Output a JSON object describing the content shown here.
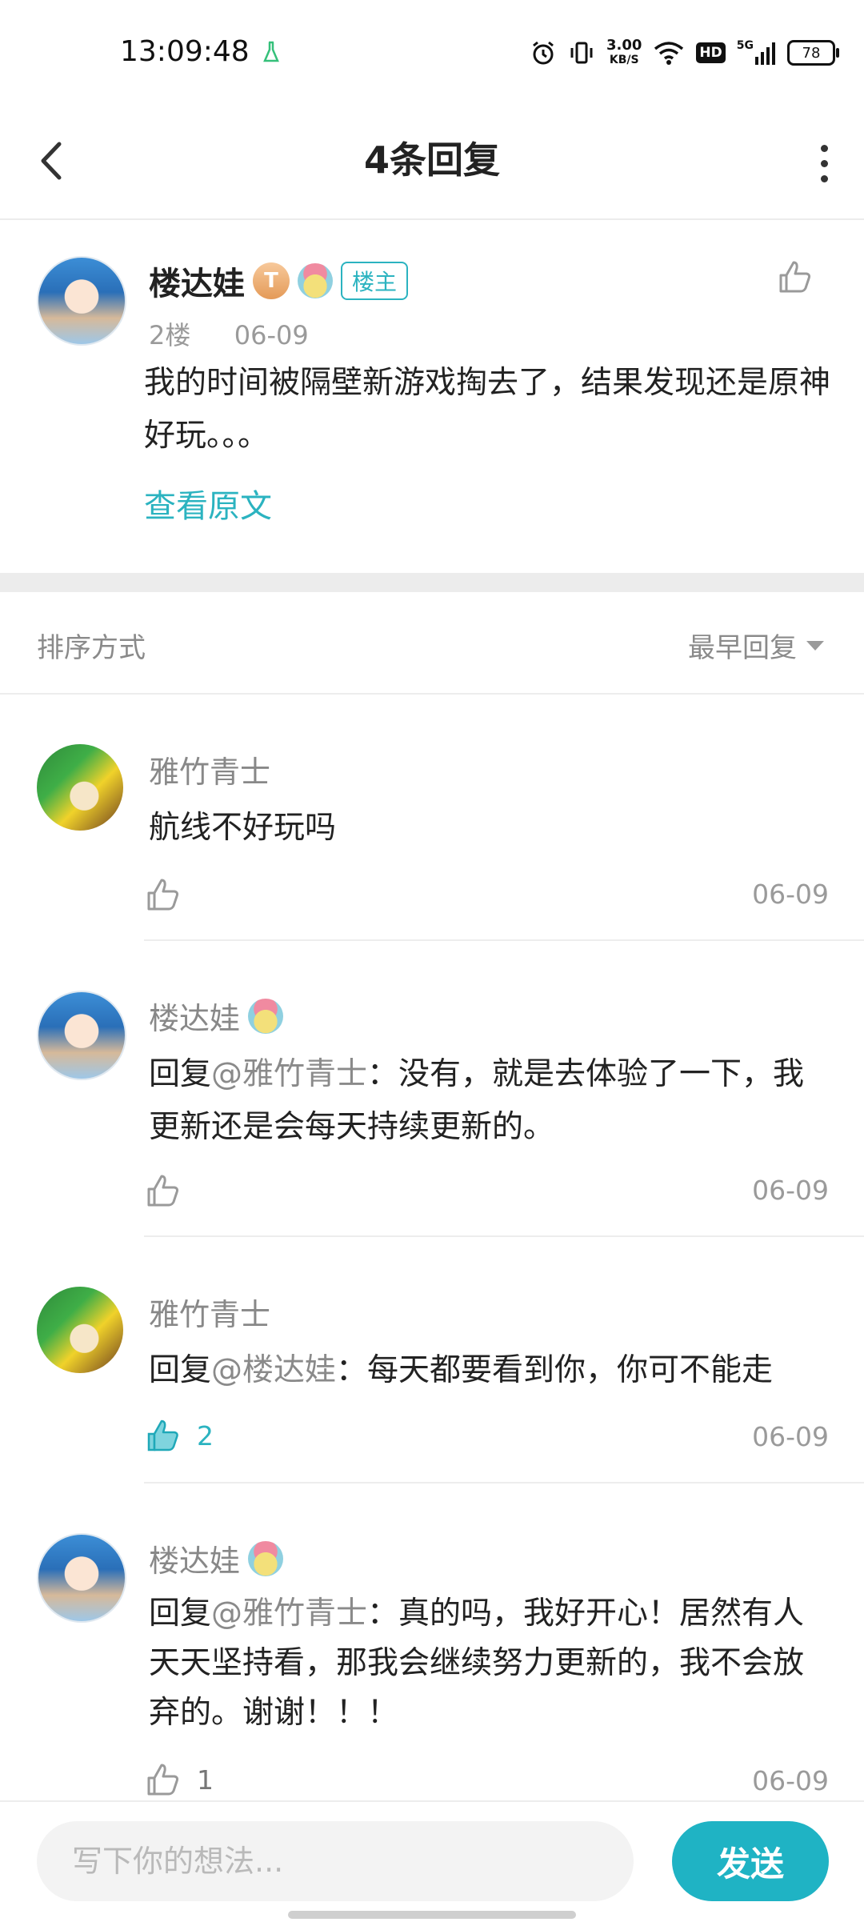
{
  "status_bar": {
    "time": "13:09:48",
    "net_speed_value": "3.00",
    "net_speed_unit": "KB/S",
    "hd": "HD",
    "signal_label": "5G",
    "battery": "78"
  },
  "nav": {
    "title": "4条回复"
  },
  "op_post": {
    "user": "楼达娃",
    "level_badge": "T",
    "owner_badge": "楼主",
    "floor": "2楼",
    "date": "06-09",
    "text": "我的时间被隔壁新游戏掏去了，结果发现还是原神好玩。。。",
    "view_original": "查看原文"
  },
  "sort": {
    "label": "排序方式",
    "value": "最早回复"
  },
  "replies": [
    {
      "user": "雅竹青士",
      "mention": "",
      "text": "航线不好玩吗",
      "likes": "",
      "date": "06-09"
    },
    {
      "user": "楼达娃",
      "prefix": "回复",
      "mention": "@雅竹青士",
      "text": "：没有，就是去体验了一下，我更新还是会每天持续更新的。",
      "likes": "",
      "date": "06-09"
    },
    {
      "user": "雅竹青士",
      "prefix": "回复",
      "mention": "@楼达娃",
      "text": "：每天都要看到你，你可不能走",
      "likes": "2",
      "date": "06-09"
    },
    {
      "user": "楼达娃",
      "prefix": "回复",
      "mention": "@雅竹青士",
      "text": "：真的吗，我好开心！居然有人天天坚持看，那我会继续努力更新的，我不会放弃的。谢谢！！！",
      "likes": "1",
      "date": "06-09"
    }
  ],
  "composer": {
    "placeholder": "写下你的想法...",
    "send_label": "发送"
  },
  "colors": {
    "accent": "#1fb3c4",
    "link": "#2bb3c0"
  }
}
